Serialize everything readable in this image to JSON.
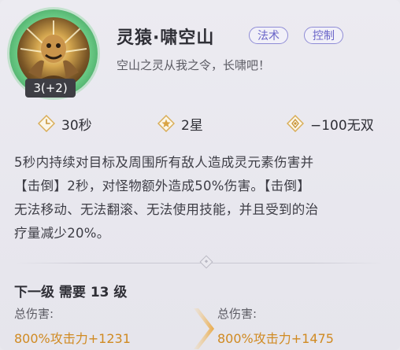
{
  "skill": {
    "name": "灵猿·啸空山",
    "level_badge": "3(+2)",
    "tags": [
      "法术",
      "控制"
    ],
    "subtitle": "空山之灵从我之令，长啸吧！",
    "icon": "ape-spirit-skill-icon"
  },
  "stats": {
    "cooldown": "30秒",
    "star": "2星",
    "invincibility": "−100无双"
  },
  "description": {
    "lines": [
      "5秒内持续对目标及周围所有敌人造成灵元素伤害并",
      "【击倒】2秒，对怪物额外造成50%伤害。【击倒】",
      "无法移动、无法翻滚、无法使用技能，并且受到的治",
      "疗量减少20%。"
    ]
  },
  "next_level": {
    "title": "下一级 需要 13 级",
    "current_label": "总伤害:",
    "current_value": "800%攻击力+1231",
    "next_label": "总伤害:",
    "next_value": "800%攻击力+1475"
  },
  "colors": {
    "accent_tag": "#6a65c8",
    "value_orange": "#d08a22",
    "icon_ring": "#6fcf89"
  }
}
